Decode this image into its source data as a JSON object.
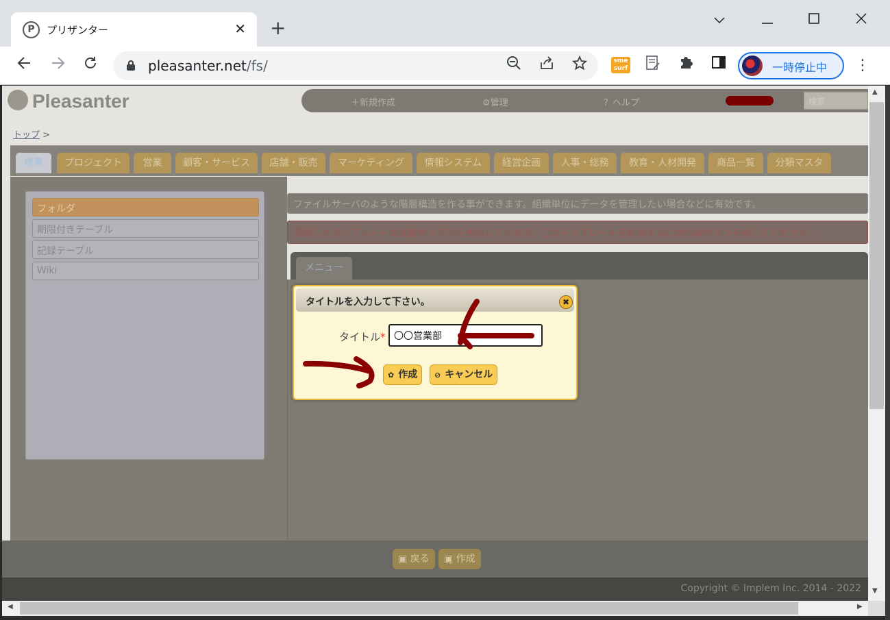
{
  "browser": {
    "tab_title": "プリザンター",
    "tab_favicon": "P",
    "tab_close": "✕",
    "new_tab": "+",
    "url_host": "pleasanter.net",
    "url_path": "/fs/",
    "profile_label": "一時停止中",
    "sm_logo": "sme surf"
  },
  "app": {
    "logo": "Pleasanter",
    "nav": [
      "＋新規作成",
      "⚙管理",
      "？ヘルプ"
    ],
    "search_placeholder": "検索",
    "breadcrumb_top": "トップ",
    "breadcrumb_sep": ">",
    "category_tabs": [
      "標準",
      "プロジェクト",
      "営業",
      "顧客・サービス",
      "店舗・販売",
      "マーケティング",
      "情報システム",
      "経営企画",
      "人事・総務",
      "教育・人材開発",
      "商品一覧",
      "分類マスタ"
    ],
    "templates": [
      "フォルダ",
      "期限付きテーブル",
      "記録テーブル",
      "Wiki"
    ],
    "info_text": "ファイルサーバのような階層構造を作る事ができます。組織単位にデータを管理したい場合などに有効です。",
    "alert_text": "選択したテンプレートの画面サンプルを表示しています。このテンプレートを利用するには作成ボタンを押してください。",
    "menu_tab": "メニュー",
    "footer_back": "戻る",
    "footer_create": "作成",
    "copyright": "Copyright © Implem Inc. 2014 - 2022"
  },
  "dialog": {
    "title": "タイトルを入力して下さい。",
    "close": "✖",
    "field_label": "タイトル",
    "required_mark": "*",
    "field_value": "〇〇営業部",
    "create_label": "作成",
    "cancel_label": "キャンセル"
  },
  "colors": {
    "dialog_border": "#e8b739",
    "dialog_bg": "#fef7d6",
    "annotation": "#8b0000",
    "accent_blue": "#1a73e8"
  }
}
